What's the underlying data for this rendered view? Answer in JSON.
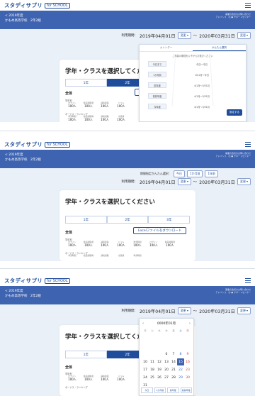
{
  "app": {
    "logo_main": "スタディサプリ",
    "logo_tag": "for SCHOOL"
  },
  "breadcrumb": {
    "year": "< 2019年度",
    "school": "かもめ高等学校　2年2組",
    "info_right": [
      "事業の改善のお問い合わせ",
      "アドバンス　の ● サポートセンター"
    ]
  },
  "period": {
    "label": "利用期間：",
    "start": "2019年04月01日",
    "end": "2020年03月31日",
    "sep": "〜",
    "change": "変更",
    "quick_label": "期間指定かんたん選択：",
    "quick": [
      "今日",
      "1か月前",
      "1年前"
    ]
  },
  "card": {
    "title": "学年・クラスを選択してください",
    "tabs": [
      "1年",
      "2年",
      "3年"
    ],
    "section": "全体",
    "download": "Excelファイルをダウンロード",
    "row1_label": "学年別",
    "row2_label": "ボーナス・ランキング",
    "stats": [
      {
        "top": "ログイン",
        "val": "100人"
      },
      {
        "top": "動画視聴者",
        "val": "100人"
      },
      {
        "top": "講義授業",
        "val": "100人"
      },
      {
        "top": "ドリル",
        "val": "100人"
      },
      {
        "top": "学習時間",
        "val": "100人"
      }
    ],
    "stats2": [
      {
        "top": "学習時間",
        "val": "100人"
      },
      {
        "top": "動画視聴時",
        "val": "100人"
      },
      {
        "top": "講義視聴",
        "val": "100人"
      },
      {
        "top": "全受講",
        "val": "100人"
      },
      {
        "top": "学習時間",
        "val": "100人"
      }
    ]
  },
  "overlay1": {
    "tabs": [
      "カレンダー",
      "かんたん選択"
    ],
    "desc": "ご希望の期間を以下からお選びください",
    "rows": [
      {
        "pill": "今日まで",
        "val": "今日〜今日"
      },
      {
        "pill": "1か月前",
        "val": "10/1月〜今日"
      },
      {
        "pill": "前年度",
        "val": "4/1月〜3/31月"
      },
      {
        "pill": "前前年度",
        "val": "4/1月〜3/31月"
      },
      {
        "pill": "今年度",
        "val": "4/1月〜3/31月"
      }
    ],
    "ok": "設定する"
  },
  "calendar": {
    "month": "0000年01月",
    "weekdays": [
      "月",
      "火",
      "水",
      "木",
      "金",
      "土",
      "日"
    ],
    "days": [
      "",
      "",
      "",
      "",
      "",
      "",
      "",
      "",
      "",
      "",
      "",
      "",
      "",
      "",
      "",
      "",
      "",
      "",
      "",
      "",
      "",
      "",
      "",
      "",
      "",
      "",
      "",
      "",
      "",
      "",
      "",
      "",
      "",
      "",
      "",
      "",
      "",
      "",
      "",
      "",
      "",
      "",
      "",
      "",
      "",
      "",
      "",
      "",
      "",
      "",
      "",
      "",
      "",
      "",
      "",
      ""
    ],
    "rows": [
      [
        "",
        "",
        "",
        "",
        "",
        "",
        ""
      ],
      [
        "",
        "",
        "",
        "",
        "",
        "",
        ""
      ],
      [
        "",
        "",
        "",
        "6",
        "7",
        "8",
        "9"
      ],
      [
        "10",
        "11",
        "12",
        "13",
        "14",
        "15",
        "16"
      ],
      [
        "17",
        "18",
        "19",
        "20",
        "21",
        "22",
        "23"
      ],
      [
        "24",
        "25",
        "26",
        "27",
        "28",
        "29",
        "30"
      ],
      [
        "31",
        "",
        "",
        "",
        "",
        "",
        ""
      ]
    ],
    "today": "15",
    "foot": [
      "今日",
      "1か月前",
      "前年度",
      "前前年度"
    ]
  },
  "colors": {
    "brand": "#1f4d9b",
    "bar": "#3e63b0",
    "bg": "#e9f0f8"
  }
}
